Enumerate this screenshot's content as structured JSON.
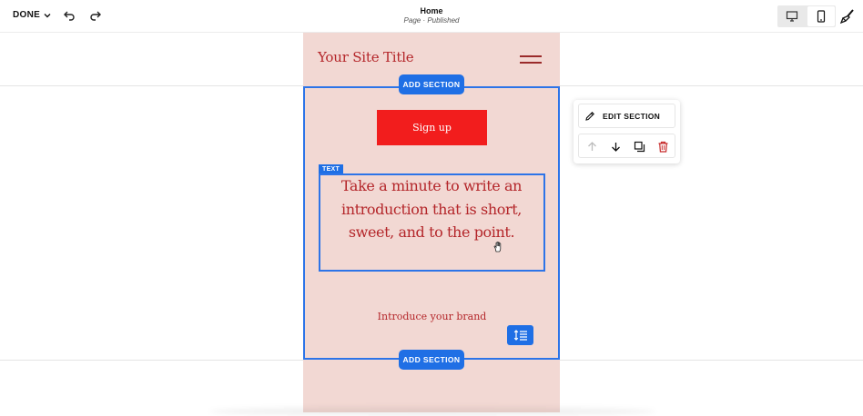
{
  "toolbar": {
    "done_label": "DONE",
    "page_title": "Home",
    "page_subtitle": "Page · Published",
    "icons": {
      "done_chevron": "chevron-down-icon",
      "undo": "undo-icon",
      "redo": "redo-icon",
      "desktop": "desktop-icon",
      "mobile": "mobile-icon",
      "design": "paintbrush-icon"
    },
    "active_device": "mobile"
  },
  "site": {
    "title": "Your Site Title",
    "signup_label": "Sign up",
    "intro_text": "Take a minute to write an introduction that is short, sweet, and to the point.",
    "brand_text": "Introduce your brand"
  },
  "editor": {
    "add_section_label": "ADD SECTION",
    "text_tag": "TEXT",
    "edit_section_label": "EDIT SECTION"
  },
  "colors": {
    "accent": "#1f6fe5",
    "page_bg": "#f2d8d3",
    "site_text": "#b4262a",
    "button_bg": "#f21d1d",
    "delete": "#c62828"
  }
}
